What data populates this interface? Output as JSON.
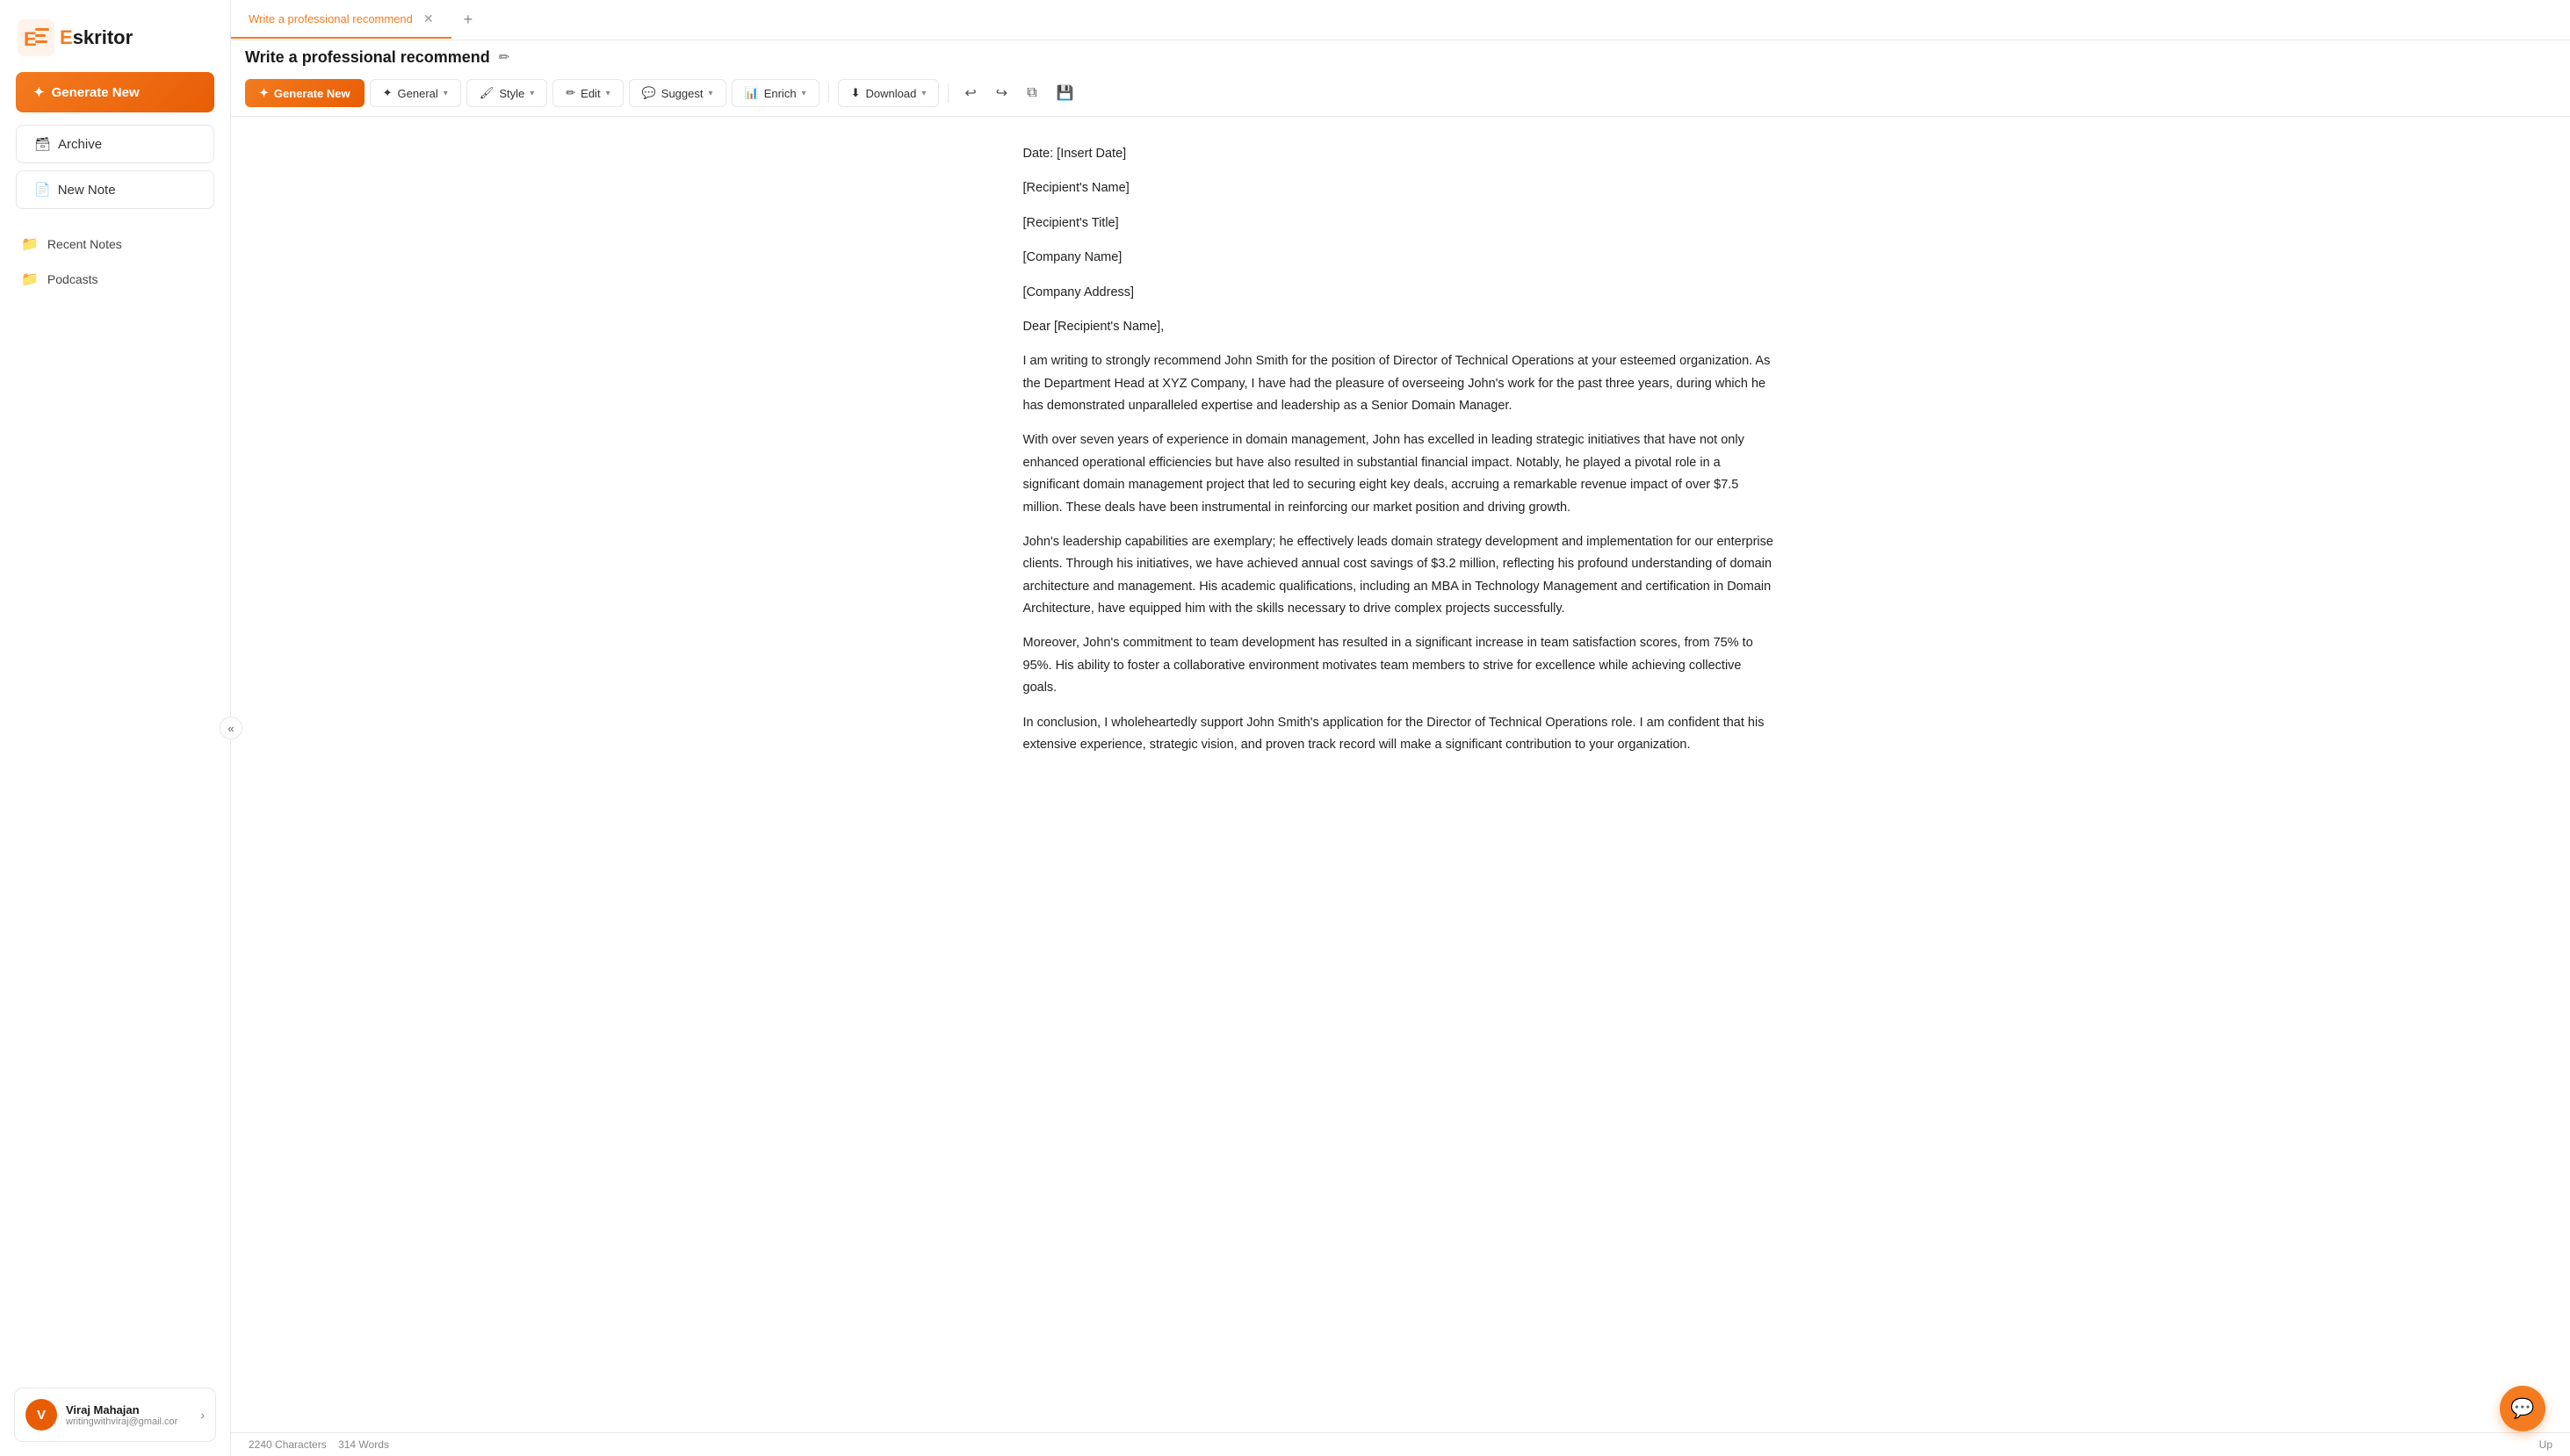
{
  "app": {
    "name": "Eskritor",
    "logo_letter": "E"
  },
  "sidebar": {
    "generate_btn": "Generate New",
    "archive_btn": "Archive",
    "new_note_btn": "New Note",
    "nav_items": [
      {
        "id": "recent-notes",
        "label": "Recent Notes",
        "icon": "folder"
      },
      {
        "id": "podcasts",
        "label": "Podcasts",
        "icon": "folder"
      }
    ],
    "user": {
      "name": "Viraj Mahajan",
      "email": "writingwithviraj@gmail.cor",
      "initials": "V"
    }
  },
  "tabs": [
    {
      "id": "tab-1",
      "label": "Write a professional recommend",
      "active": true
    }
  ],
  "toolbar": {
    "generate_btn": "Generate New",
    "general_btn": "General",
    "style_btn": "Style",
    "edit_btn": "Edit",
    "suggest_btn": "Suggest",
    "enrich_btn": "Enrich",
    "download_btn": "Download"
  },
  "document": {
    "title": "Write a professional recommend",
    "content": {
      "date_line": "Date: [Insert Date]",
      "recipient_name": "[Recipient's Name]",
      "recipient_title": "[Recipient's Title]",
      "company_name": "[Company Name]",
      "company_address": "[Company Address]",
      "salutation": "Dear [Recipient's Name],",
      "paragraph1": "I am writing to strongly recommend John Smith for the position of Director of Technical Operations at your esteemed organization. As the Department Head at XYZ Company, I have had the pleasure of overseeing John's work for the past three years, during which he has demonstrated unparalleled expertise and leadership as a Senior Domain Manager.",
      "paragraph2": "With over seven years of experience in domain management, John has excelled in leading strategic initiatives that have not only enhanced operational efficiencies but have also resulted in substantial financial impact. Notably, he played a pivotal role in a significant domain management project that led to securing eight key deals, accruing a remarkable revenue impact of over $7.5 million. These deals have been instrumental in reinforcing our market position and driving growth.",
      "paragraph3": "John's leadership capabilities are exemplary; he effectively leads domain strategy development and implementation for our enterprise clients. Through his initiatives, we have achieved annual cost savings of $3.2 million, reflecting his profound understanding of domain architecture and management. His academic qualifications, including an MBA in Technology Management and certification in Domain Architecture, have equipped him with the skills necessary to drive complex projects successfully.",
      "paragraph4": "Moreover, John's commitment to team development has resulted in a significant increase in team satisfaction scores, from 75% to 95%. His ability to foster a collaborative environment motivates team members to strive for excellence while achieving collective goals.",
      "paragraph5": "In conclusion, I wholeheartedly support John Smith's application for the Director of Technical Operations role. I am confident that his extensive experience, strategic vision, and proven track record will make a significant contribution to your organization."
    }
  },
  "status_bar": {
    "characters": "2240 Characters",
    "words": "314 Words"
  }
}
